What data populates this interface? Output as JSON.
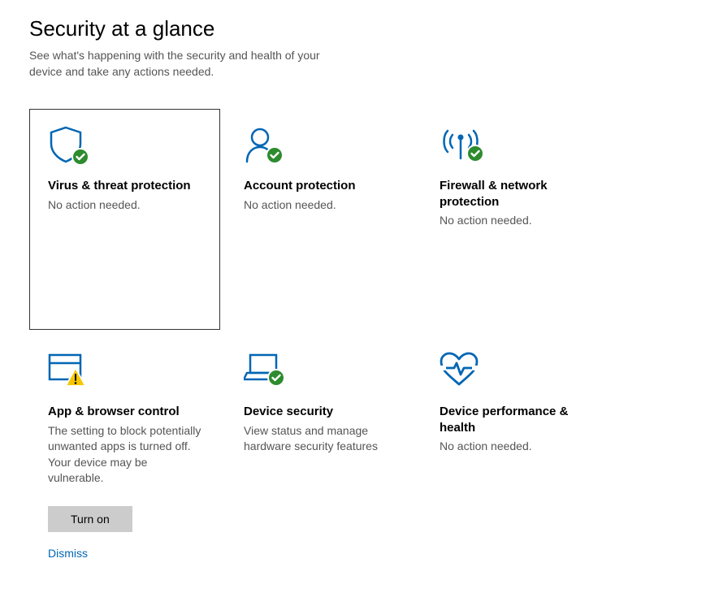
{
  "header": {
    "title": "Security at a glance",
    "subtitle": "See what's happening with the security and health of your device and take any actions needed."
  },
  "tiles": [
    {
      "title": "Virus & threat protection",
      "desc": "No action needed.",
      "status": "ok",
      "selected": true
    },
    {
      "title": "Account protection",
      "desc": "No action needed.",
      "status": "ok"
    },
    {
      "title": "Firewall & network protection",
      "desc": "No action needed.",
      "status": "ok"
    },
    {
      "title": "App & browser control",
      "desc": "The setting to block potentially unwanted apps is turned off. Your device may be vulnerable.",
      "status": "warning",
      "button": "Turn on",
      "link": "Dismiss"
    },
    {
      "title": "Device security",
      "desc": "View status and manage hardware security features",
      "status": "ok"
    },
    {
      "title": "Device performance & health",
      "desc": "No action needed.",
      "status": "ok"
    }
  ],
  "colors": {
    "accent": "#0066b4",
    "ok": "#2e8b2e",
    "warning": "#f6c700"
  }
}
